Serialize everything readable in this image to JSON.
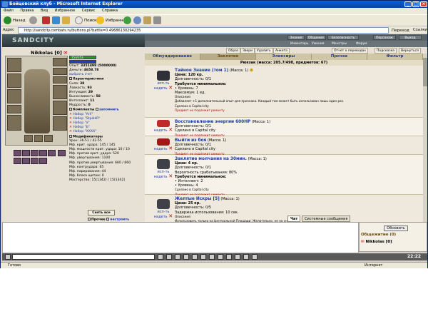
{
  "window": {
    "title": "Бойцовский клуб - Microsoft Internet Explorer"
  },
  "menu": [
    "Файл",
    "Правка",
    "Вид",
    "Избранное",
    "Сервис",
    "Справка"
  ],
  "toolbar": {
    "back": "Назад",
    "search": "Поиск",
    "favorites": "Избранное"
  },
  "address": {
    "label": "Адрес",
    "url": "http://sandcity.combats.ru/buttons.pl?battle=0.49686130294235",
    "go": "Переход",
    "links": "Ссылки"
  },
  "game": {
    "logo": "SANDCITY",
    "topnav": [
      "Знания",
      "Общение",
      "Безопасность",
      "Персонаж",
      "Выход"
    ],
    "topnav2": [
      "Инвентарь",
      "Умения",
      "Монстры",
      "Форум"
    ],
    "subnav": [
      "Образ",
      "Звери",
      "Удалить",
      "Анкета",
      "Отчет о переводах",
      "Подсказка",
      "Вернуться"
    ],
    "character": {
      "name": "Nikkolas",
      "level": "[0]",
      "hp": "153/153",
      "mp": "0/0",
      "opyt_label": "Опыт:",
      "opyt": "3351498 (5000000)",
      "den_label": "Деньги:",
      "den": "4658.78",
      "link": "выбрать счет",
      "str_label": "Сила:",
      "str": "38",
      "dex_label": "Ловкость:",
      "dex": "93",
      "int_label": "Интуиция:",
      "int": "29",
      "vyn_label": "Выносливость:",
      "vyn": "58",
      "intel_label": "Интеллект:",
      "intel": "11",
      "mud_label": "Мудрость:",
      "mud": "0"
    },
    "sections": {
      "characteristics": "Характеристики",
      "komplekty": "Комплекты",
      "zapomnit": "запомнить",
      "modifikatory": "Модификаторы"
    },
    "sets": [
      "Набор \"Arll\"",
      "Набор \"StpalkR\"",
      "Набор \"a\"",
      "Набор \"b\"",
      "Набор \"XXXX\""
    ],
    "mods": [
      "Урон: 36-51 / 42-55",
      "Мф. крит. удара: 145 / 145",
      "Мф. мощности крит. удара: 10 / 10",
      "Мф. против крит. удара: 520",
      "Мф. увертывания: 1100",
      "Мф. против увертывания: 660 / 660",
      "Мф. контрудара: 65",
      "Мф. парирования: 44",
      "Мф. блока щитом: 0",
      "Мастерство: 15(1342) / 15(1342)"
    ],
    "unequip_btn": "Снять все",
    "sections2": {
      "prochee": "Прочее",
      "nastroit": "настроить",
      "zaschita": "Защиты",
      "moshnosti": "Мощности"
    },
    "sets2": [
      "Набор \"Кукушка\"",
      "Набор \"Ловушка\"",
      "Набор \"11\"",
      "Набор \"02\""
    ],
    "tabs": [
      "Обмундирование",
      "Заклятия",
      "Эликсиры",
      "Прочее",
      "Фильтр"
    ],
    "inventory_header": "Рюкзак (масса: 205.7/490, предметов: 67)",
    "use_label": "исп-ть",
    "wear_label": "надеть",
    "items": [
      {
        "title": "Тайное Знание (том 1)",
        "mass": "(Масса: 1)",
        "lines": [
          "Цена: 120 кр.",
          "Долговечность: 0/1",
          "Требуется минимальное:",
          "• Уровень: 7",
          "Максимум: 1 ед.",
          "Описание:",
          "Добавляет +1 дополнительный опыт для признака. Каждый том может быть использован лишь один раз.",
          "Сделано в Capital city",
          "Предмет не подлежит ремонту"
        ]
      },
      {
        "title": "Восстановление энергии 600HP",
        "mass": "(Масса: 1)",
        "lines": [
          "Долговечность: 0/1",
          "Сделано в Capital city",
          "Предмет не подлежит ремонту"
        ]
      },
      {
        "title": "Выйти из боя",
        "mass": "(Масса: 1)",
        "lines": [
          "Долговечность: 0/1",
          "Сделано в Capital city",
          "Предмет не подлежит ремонту"
        ]
      },
      {
        "title": "Заклятие молчания на 30мин.",
        "mass": "(Масса: 1)",
        "lines": [
          "Цена: 4 кр.",
          "Долговечность: 0/1",
          "Вероятность срабатывания: 80%",
          "Требуется минимальное:",
          "• Интеллект: 2",
          "• Уровень: 4",
          "Сделано в Capital city",
          "Предмет не подлежит ремонту"
        ]
      },
      {
        "title": "Желтые Искры [5]",
        "mass": "(Масса: 1)",
        "lines": [
          "Цена: 25 кр.",
          "Долговечность: 0/5",
          "Задержка использования: 10 сек.",
          "Описание:",
          "Использовать только на Центральной Площади. Желательно, не на снеготаре. Зажечь и ждать."
        ]
      }
    ],
    "chat_tabs": [
      "Чат",
      "Системные сообщения"
    ],
    "online": {
      "btn": "Обновить",
      "title": "Общежитие (0)",
      "user": "Nikkolas [0]"
    },
    "clock": "22:22"
  },
  "status": {
    "left": "Готово",
    "right": "Интернет"
  }
}
